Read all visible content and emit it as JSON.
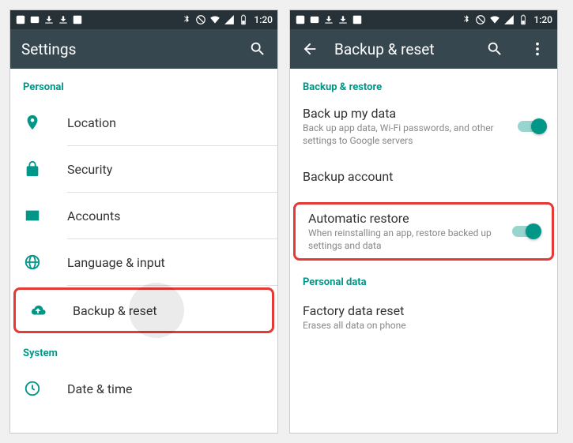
{
  "status": {
    "time": "1:20"
  },
  "left": {
    "title": "Settings",
    "section_personal": "Personal",
    "items": {
      "location": "Location",
      "security": "Security",
      "accounts": "Accounts",
      "language": "Language & input",
      "backup": "Backup & reset"
    },
    "section_system": "System",
    "items2": {
      "datetime": "Date & time"
    }
  },
  "right": {
    "title": "Backup & reset",
    "section_backup": "Backup & restore",
    "backup_data": {
      "title": "Back up my data",
      "sub": "Back up app data, Wi-Fi passwords, and other settings to Google servers"
    },
    "backup_account": {
      "title": "Backup account"
    },
    "auto_restore": {
      "title": "Automatic restore",
      "sub": "When reinstalling an app, restore backed up settings and data"
    },
    "section_personal_data": "Personal data",
    "factory": {
      "title": "Factory data reset",
      "sub": "Erases all data on phone"
    }
  }
}
